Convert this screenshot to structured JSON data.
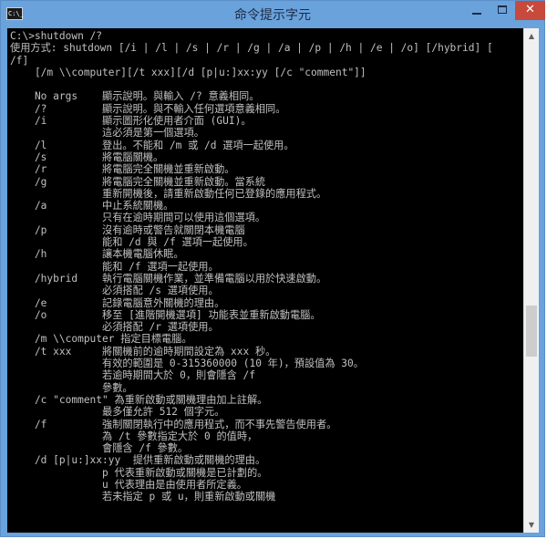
{
  "window": {
    "title": "命令提示字元",
    "icon_label": "C:\\_",
    "buttons": {
      "minimize": "minimize-icon",
      "maximize": "maximize-icon",
      "close_symbol": "✕"
    }
  },
  "console": {
    "lines": [
      "C:\\>shutdown /?",
      "使用方式: shutdown [/i | /l | /s | /r | /g | /a | /p | /h | /e | /o] [/hybrid] [",
      "/f]",
      "    [/m \\\\computer][/t xxx][/d [p|u:]xx:yy [/c \"comment\"]]",
      "",
      "    No args    顯示說明。與輸入 /? 意義相同。",
      "    /?         顯示說明。與不輸入任何選項意義相同。",
      "    /i         顯示圖形化使用者介面 (GUI)。",
      "               這必須是第一個選項。",
      "    /l         登出。不能和 /m 或 /d 選項一起使用。",
      "    /s         將電腦關機。",
      "    /r         將電腦完全關機並重新啟動。",
      "    /g         將電腦完全關機並重新啟動。當系統",
      "               重新開機後，請重新啟動任何已登錄的應用程式。",
      "    /a         中止系統關機。",
      "               只有在逾時期間可以使用這個選項。",
      "    /p         沒有逾時或警告就關閉本機電腦",
      "               能和 /d 與 /f 選項一起使用。",
      "    /h         讓本機電腦休眠。",
      "               能和 /f 選項一起使用。",
      "    /hybrid    執行電腦關機作業，並準備電腦以用於快速啟動。",
      "               必須搭配 /s 選項使用。",
      "    /e         記錄電腦意外關機的理由。",
      "    /o         移至 [進階開機選項] 功能表並重新啟動電腦。",
      "               必須搭配 /r 選項使用。",
      "    /m \\\\computer 指定目標電腦。",
      "    /t xxx     將關機前的逾時期間設定為 xxx 秒。",
      "               有效的範圍是 0-315360000 (10 年)，預設值為 30。",
      "               若逾時期間大於 0，則會隱含 /f",
      "               參數。",
      "    /c \"comment\" 為重新啟動或關機理由加上註解。",
      "               最多僅允許 512 個字元。",
      "    /f         強制關閉執行中的應用程式，而不事先警告使用者。",
      "               為 /t 參數指定大於 0 的值時，",
      "               會隱含 /f 參數。",
      "    /d [p|u:]xx:yy  提供重新啟動或關機的理由。",
      "               p 代表重新啟動或關機是已計劃的。",
      "               u 代表理由是由使用者所定義。",
      "               若未指定 p 或 u，則重新啟動或關機"
    ]
  },
  "scrollbar": {
    "up_arrow": "▲",
    "down_arrow": "▼",
    "position": 0.62
  }
}
